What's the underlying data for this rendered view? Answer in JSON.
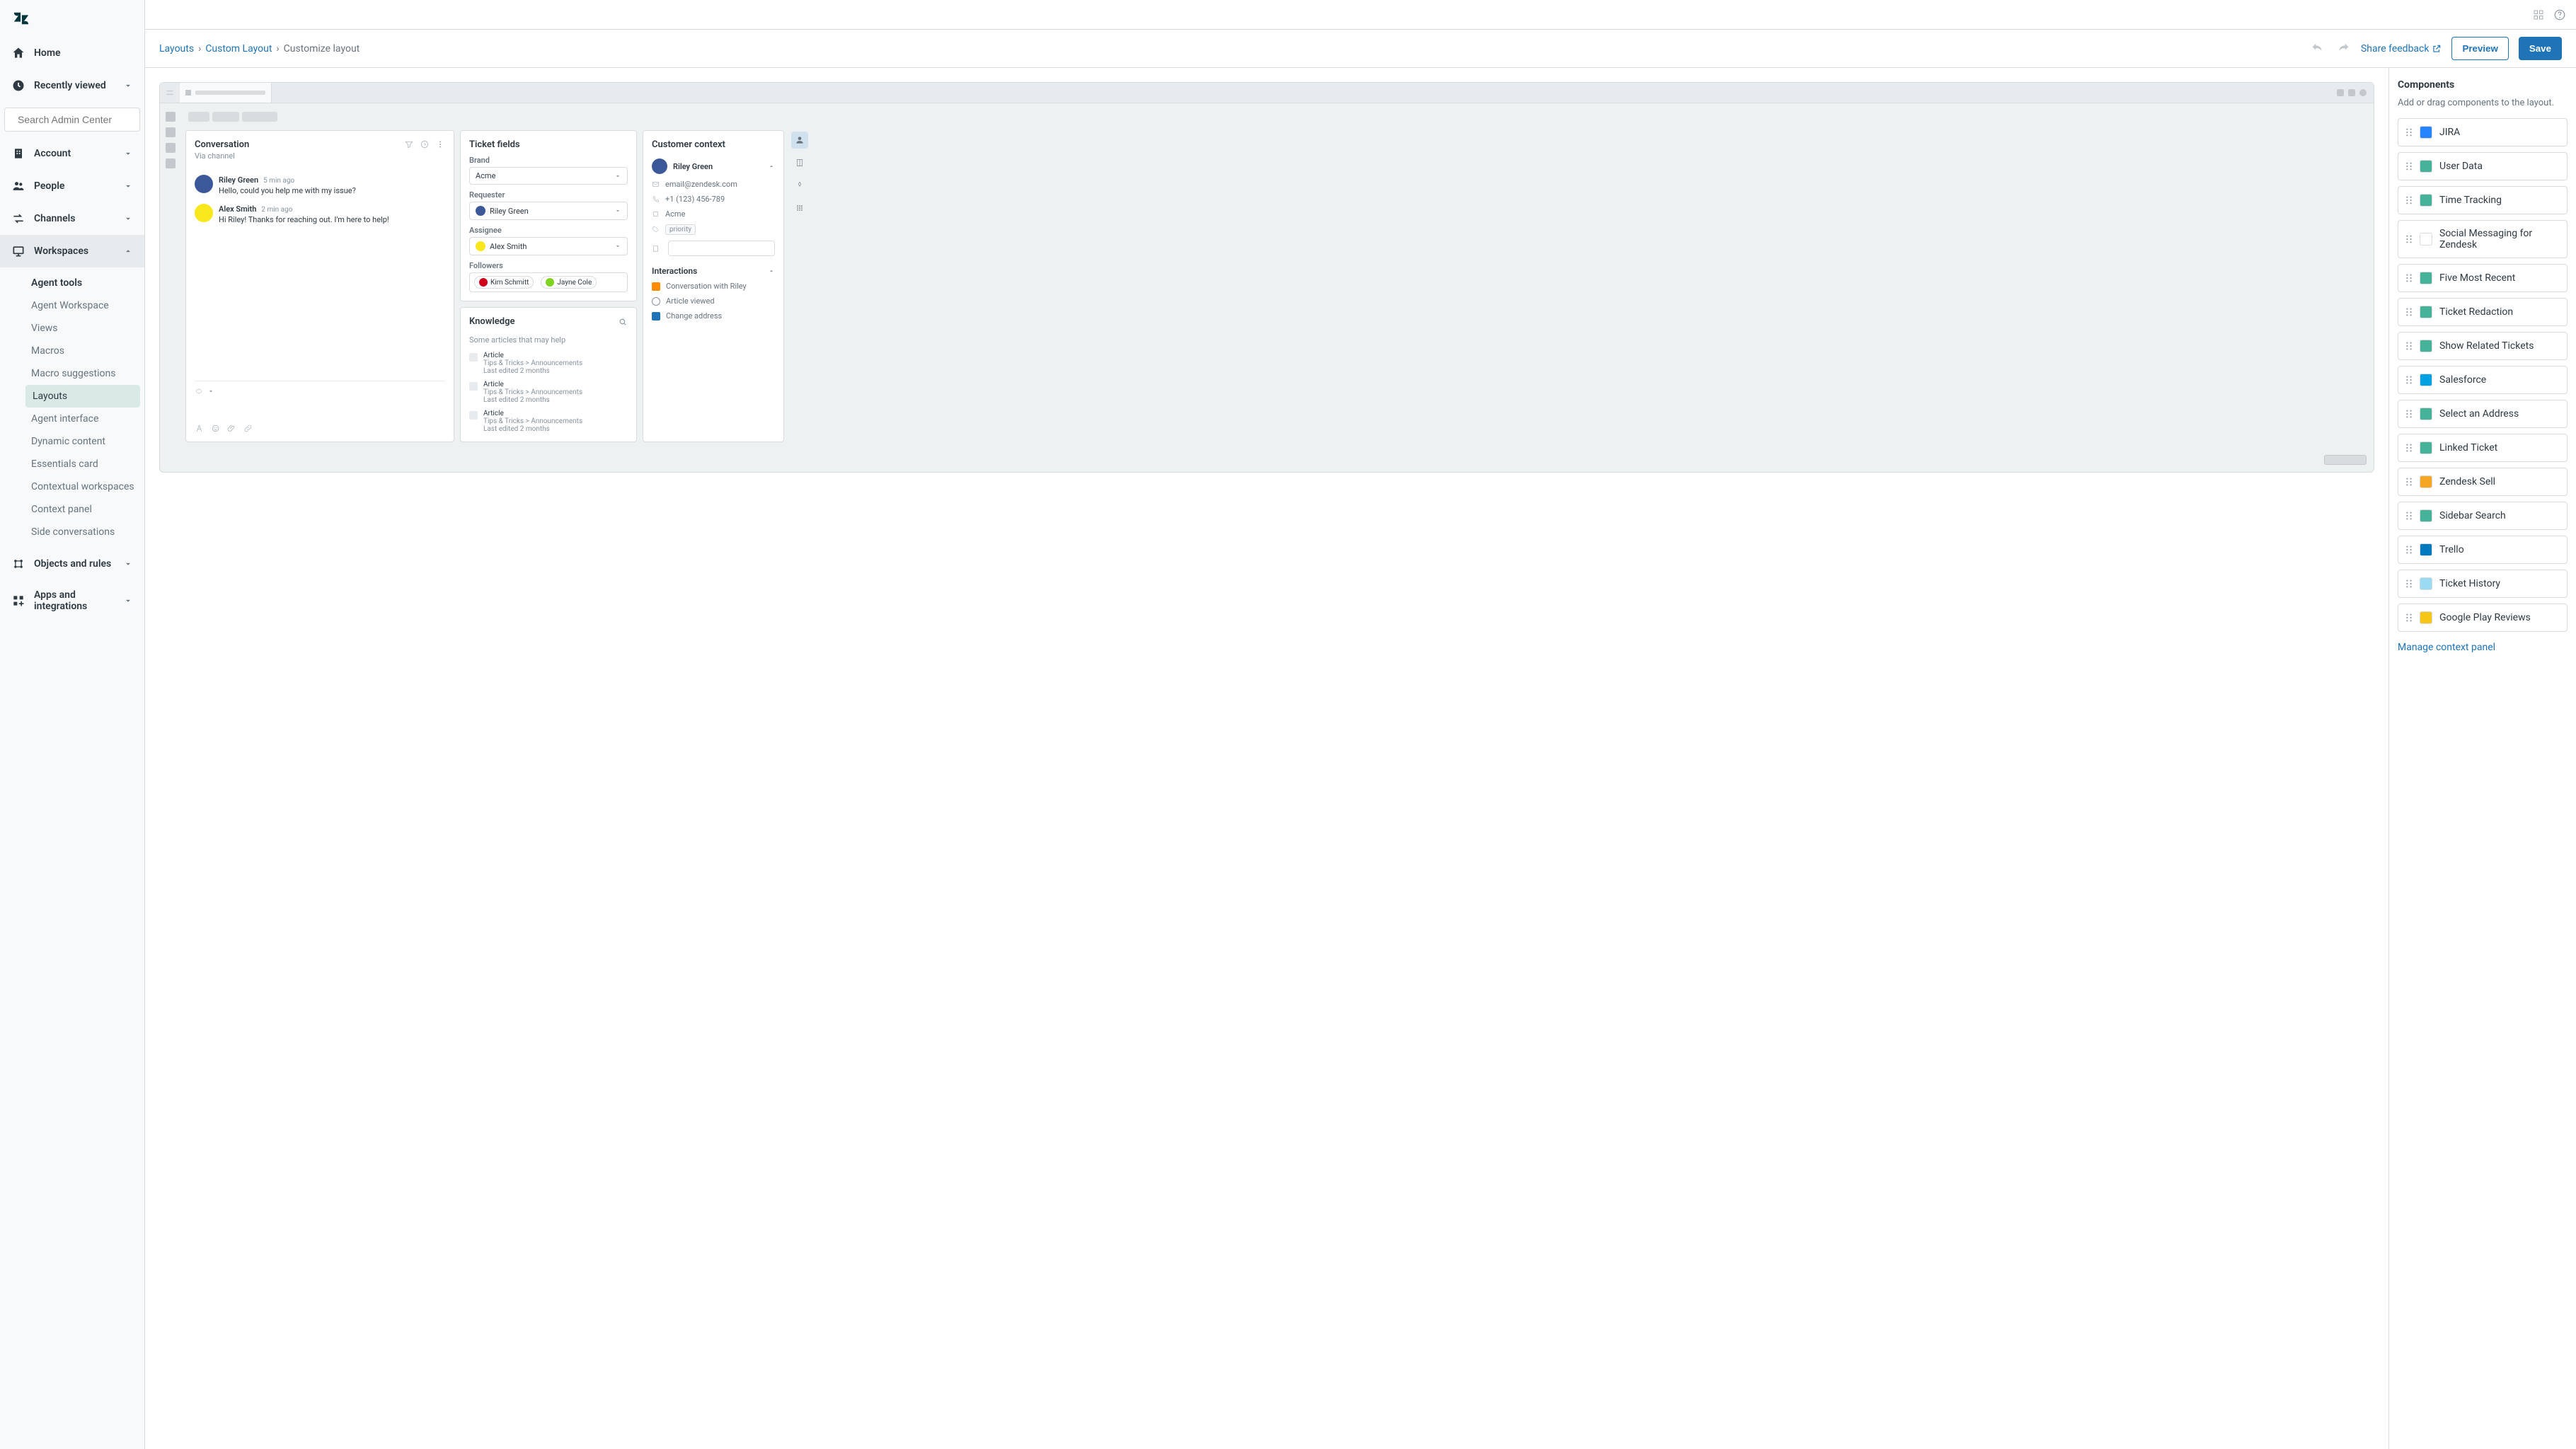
{
  "sidebar": {
    "search_placeholder": "Search Admin Center",
    "home": "Home",
    "recently_viewed": "Recently viewed",
    "account": "Account",
    "people": "People",
    "channels": "Channels",
    "workspaces": "Workspaces",
    "objects": "Objects and rules",
    "apps": "Apps and integrations",
    "workspace_items": [
      "Agent tools",
      "Agent Workspace",
      "Views",
      "Macros",
      "Macro suggestions",
      "Layouts",
      "Agent interface",
      "Dynamic content",
      "Essentials card",
      "Contextual workspaces",
      "Context panel",
      "Side conversations"
    ],
    "active_workspace_item": "Layouts"
  },
  "breadcrumb": {
    "root": "Layouts",
    "mid": "Custom Layout",
    "current": "Customize layout"
  },
  "toolbar": {
    "share": "Share feedback",
    "preview": "Preview",
    "save": "Save"
  },
  "conversation": {
    "title": "Conversation",
    "subtitle": "Via channel",
    "messages": [
      {
        "name": "Riley Green",
        "time": "5 min ago",
        "text": "Hello, could you help me with my issue?",
        "color": "#f5a623"
      },
      {
        "name": "Alex Smith",
        "time": "2 min ago",
        "text": "Hi Riley! Thanks for reaching out. I'm here to help!",
        "color": "#f8e71c"
      }
    ]
  },
  "ticket_fields": {
    "title": "Ticket fields",
    "brand_label": "Brand",
    "brand_value": "Acme",
    "requester_label": "Requester",
    "requester_value": "Riley Green",
    "assignee_label": "Assignee",
    "assignee_value": "Alex Smith",
    "followers_label": "Followers",
    "followers": [
      {
        "name": "Kim Schmitt",
        "color": "#d0021b"
      },
      {
        "name": "Jayne Cole",
        "color": "#7ed321"
      }
    ]
  },
  "knowledge": {
    "title": "Knowledge",
    "subtitle": "Some articles that may help",
    "items": [
      {
        "title": "Article",
        "path": "Tips & Tricks > Announcements",
        "edited": "Last edited 2 months"
      },
      {
        "title": "Article",
        "path": "Tips & Tricks > Announcements",
        "edited": "Last edited 2 months"
      },
      {
        "title": "Article",
        "path": "Tips & Tricks > Announcements",
        "edited": "Last edited 2 months"
      }
    ]
  },
  "customer": {
    "title": "Customer context",
    "name": "Riley Green",
    "email": "email@zendesk.com",
    "phone": "+1 (123) 456-789",
    "org": "Acme",
    "tag": "priority",
    "interactions_title": "Interactions",
    "interactions": [
      {
        "label": "Conversation with Riley",
        "color": "#ff8c00"
      },
      {
        "label": "Article viewed",
        "color": "#c2c8cc"
      },
      {
        "label": "Change address",
        "color": "#1f73b7"
      }
    ]
  },
  "components": {
    "title": "Components",
    "subtitle": "Add or drag components to the layout.",
    "manage": "Manage context panel",
    "items": [
      {
        "label": "JIRA",
        "color": "#2684ff"
      },
      {
        "label": "User Data",
        "color": "#47b29a"
      },
      {
        "label": "Time Tracking",
        "color": "#47b29a"
      },
      {
        "label": "Social Messaging for Zendesk",
        "color": "#ffffff"
      },
      {
        "label": "Five Most Recent",
        "color": "#47b29a"
      },
      {
        "label": "Ticket Redaction",
        "color": "#47b29a"
      },
      {
        "label": "Show Related Tickets",
        "color": "#47b29a"
      },
      {
        "label": "Salesforce",
        "color": "#00a1e0"
      },
      {
        "label": "Select an Address",
        "color": "#47b29a"
      },
      {
        "label": "Linked Ticket",
        "color": "#47b29a"
      },
      {
        "label": "Zendesk Sell",
        "color": "#f5a623"
      },
      {
        "label": "Sidebar Search",
        "color": "#47b29a"
      },
      {
        "label": "Trello",
        "color": "#0079bf"
      },
      {
        "label": "Ticket History",
        "color": "#9bdaf3"
      },
      {
        "label": "Google Play Reviews",
        "color": "#f5c518"
      }
    ]
  }
}
